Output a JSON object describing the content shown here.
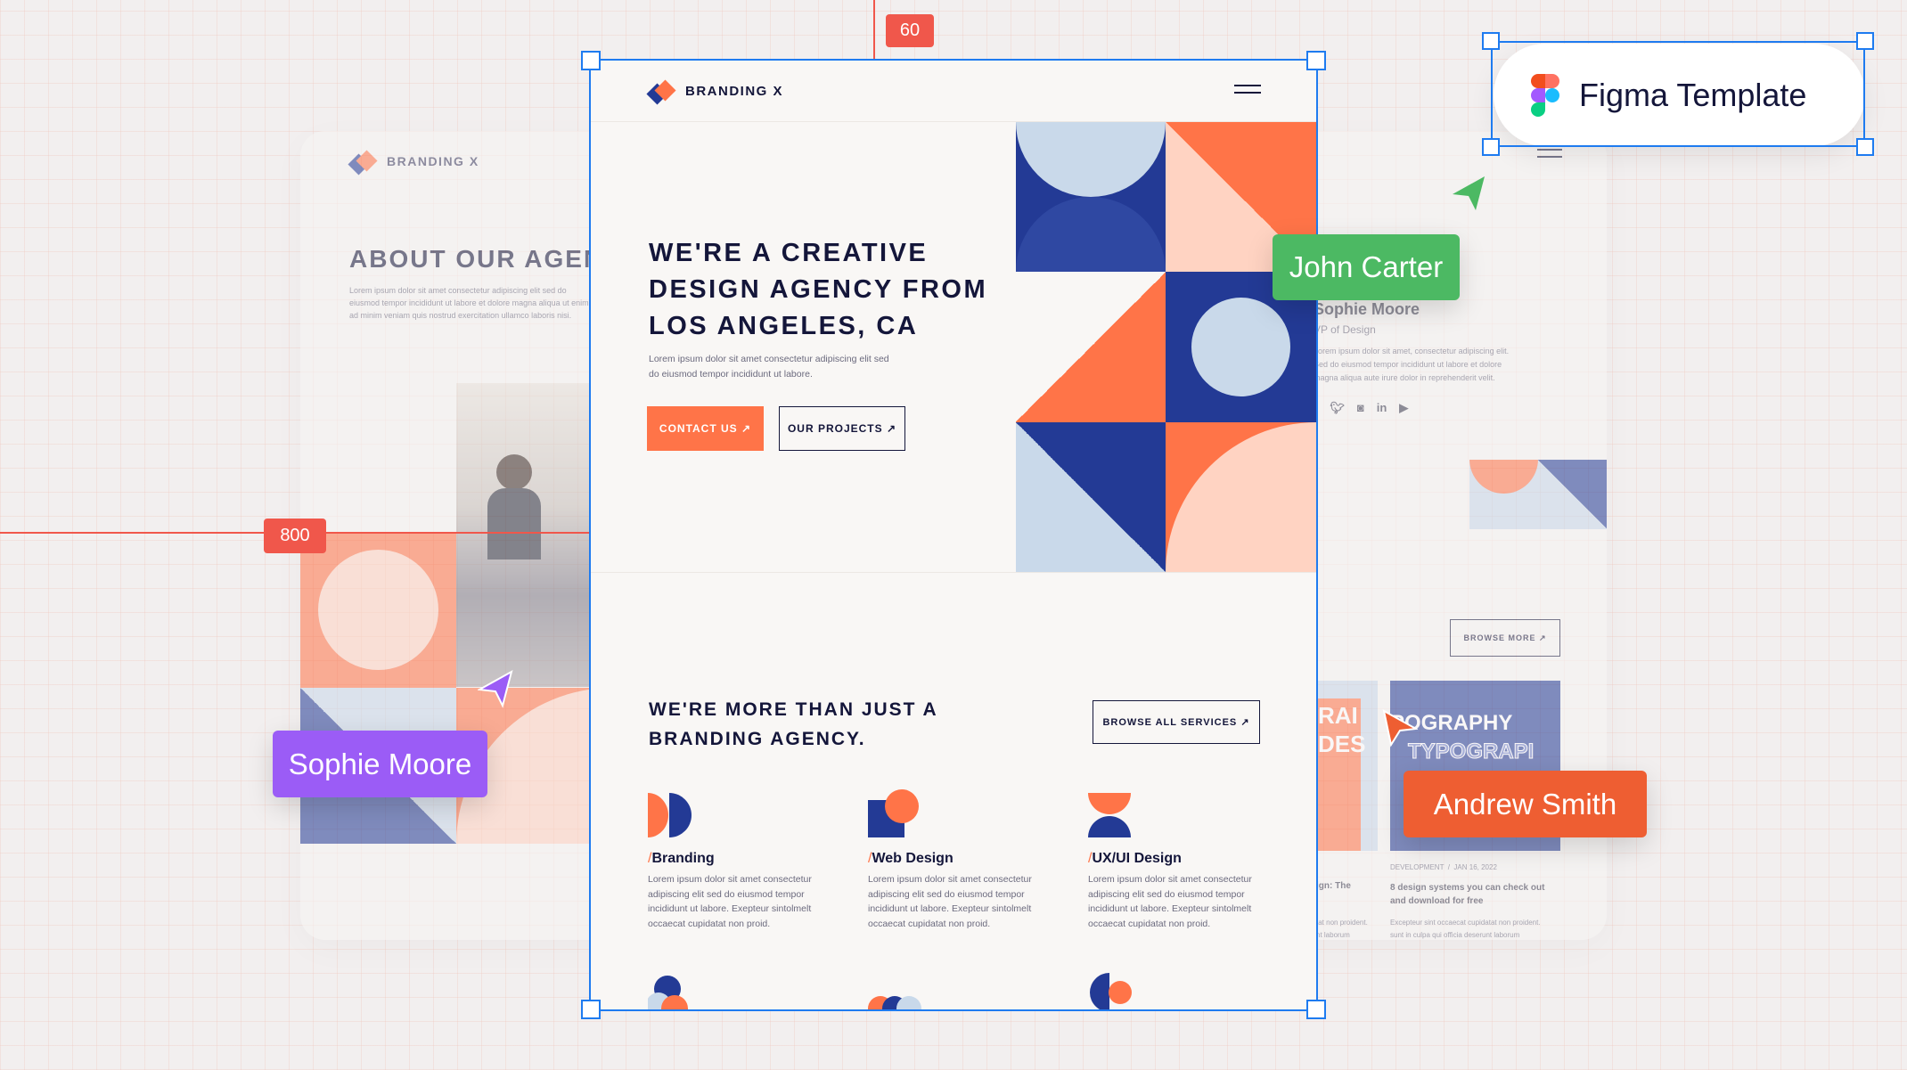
{
  "colors": {
    "orange": "#FF7448",
    "navy": "#233A95",
    "light_blue": "#C9D9EA",
    "peach": "#FFD3C2",
    "dark": "#14163A",
    "selection": "#1E7BF0",
    "guide": "#F0574B"
  },
  "badge": {
    "label": "Figma Template",
    "icon": "figma-logo-icon"
  },
  "guides": {
    "vertical_label": "60",
    "horizontal_label": "800"
  },
  "cursors": [
    {
      "name": "John Carter",
      "color": "#4CB963"
    },
    {
      "name": "Sophie Moore",
      "color": "#9B5CF6"
    },
    {
      "name": "Andrew Smith",
      "color": "#EE5E32"
    }
  ],
  "left_card": {
    "logo": "BRANDING X",
    "title": "ABOUT OUR AGEN",
    "text": [
      "Lorem ipsum dolor sit amet consectetur adipiscing elit sed do",
      "eiusmod tempor incididunt ut labore et dolore magna aliqua ut enim",
      "ad minim veniam quis nostrud exercitation ullamco laboris nisi."
    ]
  },
  "right_card": {
    "name": "Sophie Moore",
    "role": "VP of Design",
    "text": [
      "Lorem ipsum dolor sit amet, consectetur adipiscing elit.",
      "Sed do eiusmod tempor incididunt ut labore et dolore",
      "magna aliqua aute irure dolor in reprehenderit velit."
    ],
    "socials": [
      "facebook-icon",
      "twitter-icon",
      "instagram-icon",
      "linkedin-icon",
      "youtube-icon"
    ],
    "browse_more": "BROWSE MORE ↗",
    "blog": {
      "img1_text": [
        "RAI",
        "DES"
      ],
      "img2_text": [
        "POGRAPHY",
        "TYPOGRAPI"
      ],
      "meta": "DEVELOPMENT  /  JAN 16, 2022",
      "title": [
        "8 design systems you can check out",
        "and download for free"
      ],
      "desc": [
        "Excepteur sint occaecat cupidatat non proident.",
        "sunt in culpa qui officia deserunt laborum"
      ],
      "partial_title": "ign: The",
      "partial_desc": [
        "tat non proident.",
        "nt laborum"
      ]
    }
  },
  "main": {
    "logo": "BRANDING X",
    "hero": {
      "title": [
        "WE'RE A CREATIVE",
        "DESIGN AGENCY FROM",
        "LOS ANGELES, CA"
      ],
      "text": [
        "Lorem ipsum dolor sit amet consectetur adipiscing elit sed",
        "do eiusmod tempor incididunt ut labore."
      ],
      "contact": "CONTACT US ↗",
      "projects": "OUR PROJECTS ↗"
    },
    "services": {
      "title": [
        "WE'RE MORE THAN JUST A",
        "BRANDING AGENCY."
      ],
      "browse": "BROWSE ALL SERVICES ↗",
      "items": [
        {
          "title": "Branding",
          "text": [
            "Lorem ipsum dolor sit amet consectetur",
            "adipiscing elit sed do eiusmod tempor",
            "incididunt ut labore. Exepteur sintolmelt",
            "occaecat cupidatat non proid."
          ]
        },
        {
          "title": "Web Design",
          "text": [
            "Lorem ipsum dolor sit amet consectetur",
            "adipiscing elit sed do eiusmod tempor",
            "incididunt ut labore. Exepteur sintolmelt",
            "occaecat cupidatat non proid."
          ]
        },
        {
          "title": "UX/UI Design",
          "text": [
            "Lorem ipsum dolor sit amet consectetur",
            "adipiscing elit sed do eiusmod tempor",
            "incididunt ut labore. Exepteur sintolmelt",
            "occaecat cupidatat non proid."
          ]
        }
      ]
    }
  }
}
